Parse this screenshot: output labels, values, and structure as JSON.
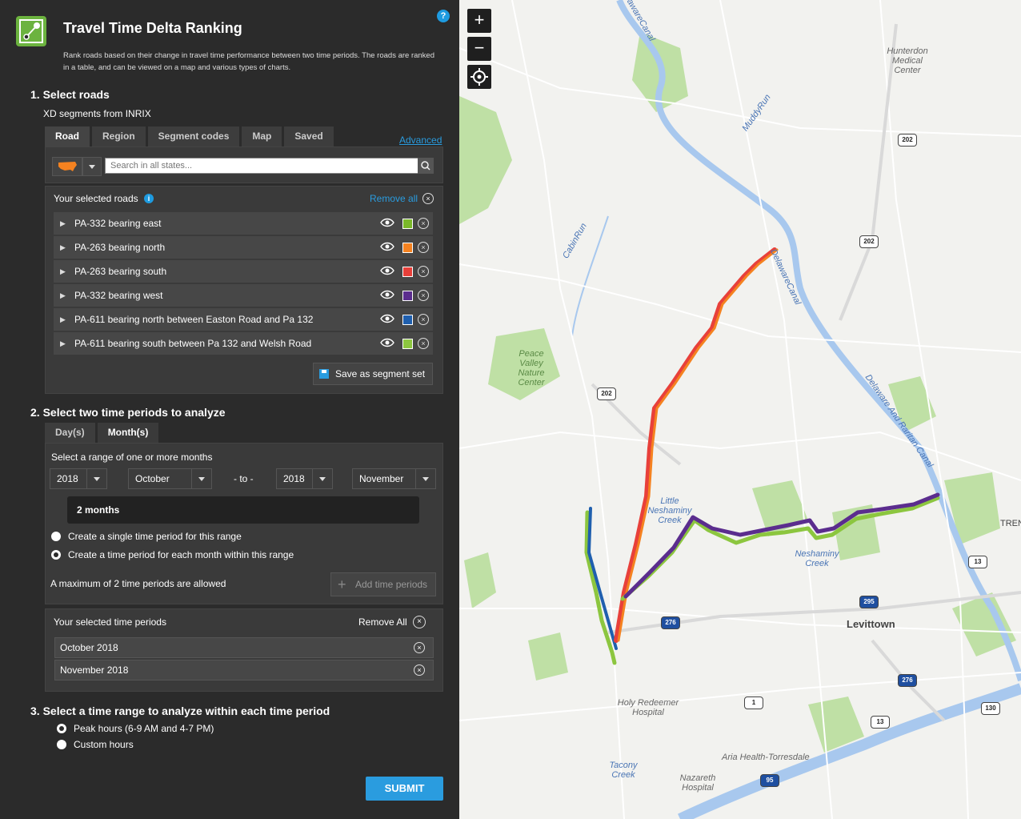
{
  "app": {
    "title": "Travel Time Delta Ranking",
    "help": "?",
    "description": "Rank roads based on their change in travel time performance between two time periods. The roads are ranked in a table, and can be viewed on a map and various types of charts."
  },
  "step1": {
    "heading": "1. Select roads",
    "source_prefix": "XD segments from",
    "source": "INRIX",
    "tabs": [
      "Road",
      "Region",
      "Segment codes",
      "Map",
      "Saved"
    ],
    "advanced": "Advanced",
    "search_placeholder": "Search in all states...",
    "selected_heading": "Your selected roads",
    "remove_all": "Remove all",
    "roads": [
      {
        "label": "PA-332 bearing east",
        "color": "#7ab829"
      },
      {
        "label": "PA-263 bearing north",
        "color": "#f58220"
      },
      {
        "label": "PA-263 bearing south",
        "color": "#e8403a"
      },
      {
        "label": "PA-332 bearing west",
        "color": "#5b2d8e"
      },
      {
        "label": "PA-611 bearing north between Easton Road and Pa 132",
        "color": "#1f5fae"
      },
      {
        "label": "PA-611 bearing south between Pa 132 and Welsh Road",
        "color": "#8cc63f"
      }
    ],
    "save_set": "Save as segment set"
  },
  "step2": {
    "heading": "2. Select two time periods to analyze",
    "tabs": [
      "Day(s)",
      "Month(s)"
    ],
    "range_label": "Select a range of one or more months",
    "from_year": "2018",
    "from_month": "October",
    "to_text": "- to -",
    "to_year": "2018",
    "to_month": "November",
    "duration": "2 months",
    "option_single": "Create a single time period for this range",
    "option_each": "Create a time period for each month within this range",
    "max_note": "A maximum of 2 time periods are allowed",
    "add_periods": "Add time periods",
    "selected_heading": "Your selected time periods",
    "remove_all": "Remove All",
    "periods": [
      "October 2018",
      "November 2018"
    ]
  },
  "step3": {
    "heading": "3. Select a time range to analyze within each time period",
    "option_peak": "Peak hours (6-9 AM and 4-7 PM)",
    "option_custom": "Custom hours"
  },
  "submit": "SUBMIT",
  "map": {
    "zoom_in": "+",
    "zoom_out": "−",
    "labels": {
      "hunterdon": "Hunterdon\nMedical\nCenter",
      "muddy_run": "MuddyRun",
      "cabin_run": "CabinRun",
      "delaware_canal_top": "DelawareCanal",
      "delaware_canal": "DelawareCanal",
      "raritan_canal": "Delaware And Raritan Canal",
      "peace_valley": "Peace\nValley\nNature\nCenter",
      "little_neshaminy": "Little\nNeshaminy\nCreek",
      "neshaminy": "Neshaminy\nCreek",
      "levittown": "Levittown",
      "holy_redeemer": "Holy Redeemer\nHospital",
      "aria": "Aria Health-Torresdale",
      "tacony": "Tacony\nCreek",
      "nazareth": "Nazareth\nHospital",
      "tren": "TREN"
    },
    "shields": [
      "202",
      "202",
      "202",
      "276",
      "295",
      "276",
      "13",
      "1",
      "13",
      "130",
      "95"
    ]
  }
}
